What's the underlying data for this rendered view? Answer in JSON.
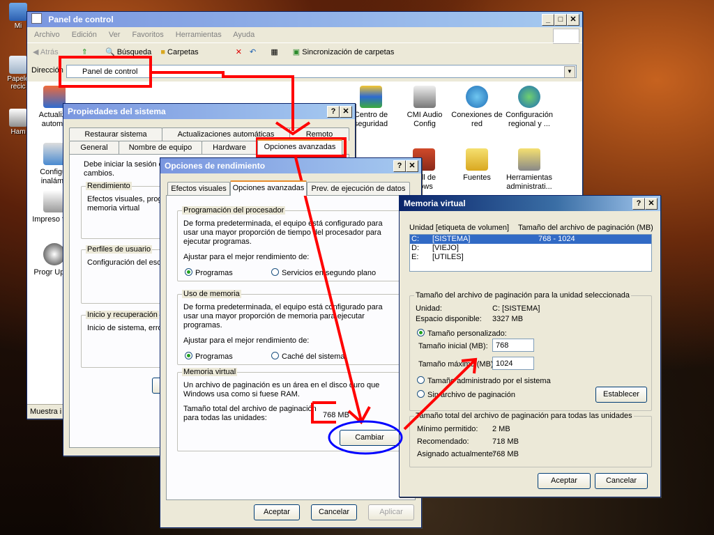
{
  "desktop": {
    "icons": [
      {
        "label": "Mi"
      },
      {
        "label": "Papele recic"
      },
      {
        "label": "Ham"
      }
    ]
  },
  "control_panel": {
    "title": "Panel de control",
    "menu": [
      "Archivo",
      "Edición",
      "Ver",
      "Favoritos",
      "Herramientas",
      "Ayuda"
    ],
    "toolbar": {
      "back": "Atrás",
      "search": "Búsqueda",
      "folders": "Carpetas",
      "sync": "Sincronización de carpetas"
    },
    "address_label": "Dirección",
    "address_value": "Panel de control",
    "items": [
      {
        "label": "Actualiza automá"
      },
      {
        "label": "Centro de seguridad"
      },
      {
        "label": "CMI Audio Config"
      },
      {
        "label": "Conexiones de red"
      },
      {
        "label": "Configuración regional y ..."
      },
      {
        "label": "Configur inalámb"
      },
      {
        "label": "wall de dows"
      },
      {
        "label": "Fuentes"
      },
      {
        "label": "Herramientas administrati..."
      },
      {
        "label": "Impreso faxe"
      },
      {
        "label": "Progr Updat"
      }
    ],
    "status": "Muestra i"
  },
  "system_props": {
    "title": "Propiedades del sistema",
    "tabs_row1": [
      "Restaurar sistema",
      "Actualizaciones automáticas",
      "Remoto"
    ],
    "tabs_row2": [
      "General",
      "Nombre de equipo",
      "Hardware",
      "Opciones avanzadas"
    ],
    "intro": [
      "Debe iniciar la sesión c",
      "cambios."
    ],
    "perf_group": "Rendimiento",
    "perf_text": [
      "Efectos visuales, prog",
      "memoria virtual"
    ],
    "profiles_group": "Perfiles de usuario",
    "profiles_text": "Configuración del escr",
    "startup_group": "Inicio y recuperación",
    "startup_text": "Inicio de sistema, error"
  },
  "perf_options": {
    "title": "Opciones de rendimiento",
    "tabs": [
      "Efectos visuales",
      "Opciones avanzadas",
      "Prev. de ejecución de datos"
    ],
    "cpu_group": "Programación del procesador",
    "cpu_text": [
      "De forma predeterminada, el equipo está configurado para",
      "usar una mayor proporción de tiempo del procesador para",
      "ejecutar programas."
    ],
    "cpu_adjust": "Ajustar para el mejor rendimiento de:",
    "cpu_opt1": "Programas",
    "cpu_opt2": "Servicios en segundo plano",
    "mem_group": "Uso de memoria",
    "mem_text": [
      "De forma predeterminada, el equipo está configurado para",
      "usar una mayor proporción de memoria para ejecutar",
      "programas."
    ],
    "mem_adjust": "Ajustar para el mejor rendimiento de:",
    "mem_opt1": "Programas",
    "mem_opt2": "Caché del sistema",
    "vm_group": "Memoria virtual",
    "vm_text": [
      "Un archivo de paginación es un área en el disco duro que",
      "Windows usa como si fuese RAM."
    ],
    "vm_total_label": [
      "Tamaño total del archivo de paginación",
      "para todas las unidades:"
    ],
    "vm_total_value": "768 MB",
    "change_button": "Cambiar",
    "ok": "Aceptar",
    "cancel": "Cancelar",
    "apply": "Aplicar"
  },
  "virtual_memory": {
    "title": "Memoria virtual",
    "header_drive": "Unidad  [etiqueta de volumen]",
    "header_size": "Tamaño del archivo de paginación (MB)",
    "drives": [
      {
        "drive": "C:",
        "label": "[SISTEMA]",
        "size": "768 - 1024"
      },
      {
        "drive": "D:",
        "label": "[VIEJO]",
        "size": ""
      },
      {
        "drive": "E:",
        "label": "[UTILES]",
        "size": ""
      }
    ],
    "sel_group": "Tamaño del archivo de paginación para la unidad seleccionada",
    "unit_label": "Unidad:",
    "unit_value": "C:  [SISTEMA]",
    "space_label": "Espacio disponible:",
    "space_value": "3327 MB",
    "custom_size": "Tamaño personalizado:",
    "initial_label": "Tamaño inicial (MB):",
    "initial_value": "768",
    "max_label": "Tamaño máximo (MB):",
    "max_value": "1024",
    "system_managed": "Tamaño administrado por el sistema",
    "no_paging": "Sin archivo de paginación",
    "set_button": "Establecer",
    "total_group": "Tamaño total del archivo de paginación para todas las unidades",
    "min_label": "Mínimo permitido:",
    "min_value": "2 MB",
    "rec_label": "Recomendado:",
    "rec_value": "718 MB",
    "cur_label": "Asignado actualmente:",
    "cur_value": "768 MB",
    "ok": "Aceptar",
    "cancel": "Cancelar"
  }
}
